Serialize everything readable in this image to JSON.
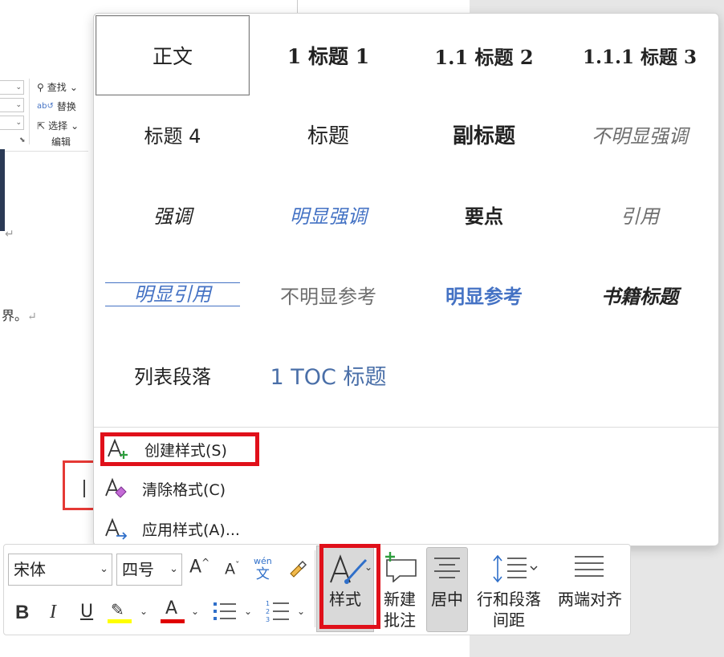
{
  "ribbon": {
    "find_label": "查找",
    "replace_label": "替换",
    "select_label": "选择",
    "group_label": "编辑"
  },
  "document": {
    "line_text": "界。",
    "para_mark": "↵"
  },
  "styles_gallery": {
    "items": [
      {
        "label": "正文"
      },
      {
        "label": "1  标题 1"
      },
      {
        "label": "1.1  标题 2"
      },
      {
        "label": "1.1.1  标题 3"
      },
      {
        "label": "标题 4"
      },
      {
        "label": "标题"
      },
      {
        "label": "副标题"
      },
      {
        "label": "不明显强调"
      },
      {
        "label": "强调"
      },
      {
        "label": "明显强调"
      },
      {
        "label": "要点"
      },
      {
        "label": "引用"
      },
      {
        "label": "明显引用"
      },
      {
        "label": "不明显参考"
      },
      {
        "label": "明显参考"
      },
      {
        "label": "书籍标题"
      },
      {
        "label": "列表段落"
      },
      {
        "label": "1  TOC 标题"
      }
    ],
    "selected": "正文",
    "menu": {
      "create_style": "创建样式(S)",
      "clear_format": "清除格式(C)",
      "apply_style": "应用样式(A)..."
    }
  },
  "toolbar": {
    "font_name": "宋体",
    "font_size": "四号",
    "grow_font": "A",
    "shrink_font": "A",
    "phonetic_top": "wén",
    "phonetic_bottom": "文",
    "bold": "B",
    "italic": "I",
    "underline": "U",
    "font_color": "A",
    "styles_label": "样式",
    "new_comment_line1": "新建",
    "new_comment_line2": "批注",
    "center_label": "居中",
    "line_spacing_line1": "行和段落",
    "line_spacing_line2": "间距",
    "justify_label": "两端对齐"
  },
  "colors": {
    "highlight_red": "#e0101a",
    "accent_blue": "#4472c4",
    "highlight_yellow": "#ffff00",
    "font_color_red": "#e00000",
    "create_icon_green": "#2e9e3e"
  }
}
